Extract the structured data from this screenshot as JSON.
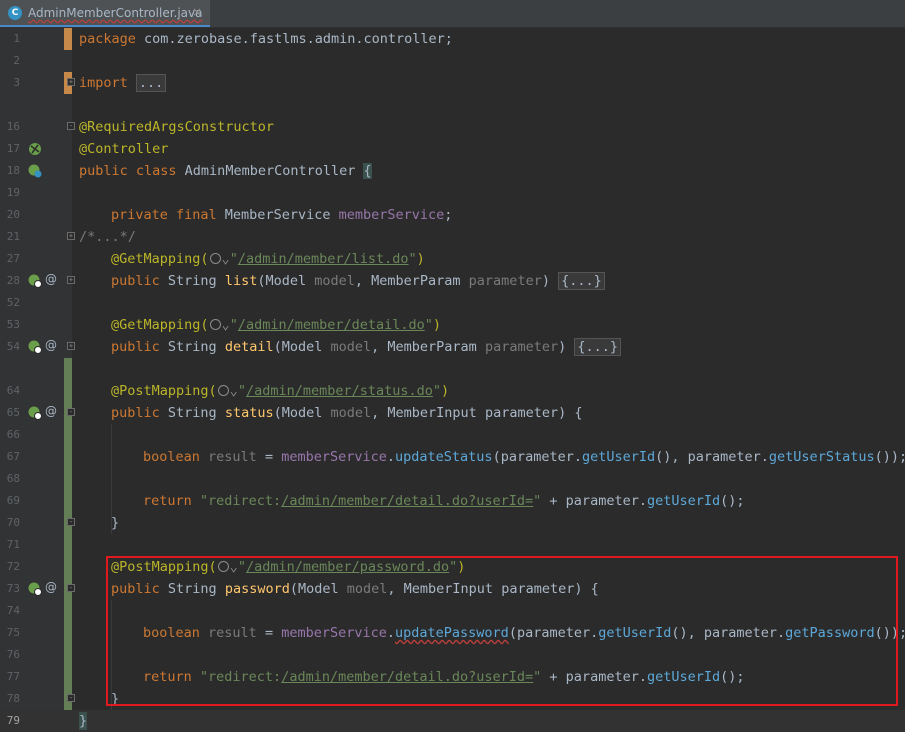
{
  "tab": {
    "filename": "AdminMemberController.java",
    "close": "×",
    "icon_letter": "C"
  },
  "line_numbers": [
    "1",
    "2",
    "3",
    "16",
    "17",
    "18",
    "19",
    "20",
    "21",
    "27",
    "28",
    "52",
    "53",
    "54",
    "64",
    "65",
    "66",
    "67",
    "68",
    "69",
    "70",
    "71",
    "72",
    "73",
    "74",
    "75",
    "76",
    "77",
    "78",
    "79"
  ],
  "code": {
    "l1_kw": "package",
    "l1_rest": " com.zerobase.fastlms.admin.controller;",
    "l3_kw": "import",
    "l3_fold": "...",
    "l16": "@RequiredArgsConstructor",
    "l17": "@Controller",
    "l18_kw": "public class",
    "l18_name": " AdminMemberController ",
    "l18_brace": "{",
    "l20_kw": "private final",
    "l20_type": " MemberService ",
    "l20_field": "memberService",
    "l20_end": ";",
    "l21": "/*...*/",
    "l27_ann": "@GetMapping(",
    "l27_q1": "\"",
    "l27_url": "/admin/member/list.do",
    "l27_q2": "\"",
    "l27_end": ")",
    "l28_kw": "public",
    "l28_type": " String ",
    "l28_m": "list",
    "l28_params": "(Model ",
    "l28_p1": "model",
    "l28_sep": ", MemberParam ",
    "l28_p2": "parameter",
    "l28_close": ") ",
    "l28_fold": "{...}",
    "l53_ann": "@GetMapping(",
    "l53_url": "/admin/member/detail.do",
    "l54_m": "detail",
    "l54_fold": "{...}",
    "l64_ann": "@PostMapping(",
    "l64_url": "/admin/member/status.do",
    "l65_m": "status",
    "l65_sep": ", MemberInput ",
    "l67_kw": "boolean",
    "l67_var": " result",
    "l67_eq": " = ",
    "l67_fld": "memberService",
    "l67_dot": ".",
    "l67_call": "updateStatus",
    "l67_p": "(parameter.",
    "l67_g1": "getUserId",
    "l67_m": "(), parameter.",
    "l67_g2": "getUserStatus",
    "l67_end": "());",
    "l69_kw": "return",
    "l69_str1": " \"redirect:",
    "l69_url": "/admin/member/detail.do?userId=",
    "l69_str2": "\"",
    "l69_plus": " + parameter.",
    "l69_call": "getUserId",
    "l69_end": "();",
    "l70": "}",
    "l72_ann": "@PostMapping(",
    "l72_url": "/admin/member/password.do",
    "l73_m": "password",
    "l75_call": "updatePassword",
    "l75_g2": "getPassword",
    "l78": "}",
    "l79": "}"
  },
  "colors": {
    "highlight_box": "#e0191f",
    "keyword": "#cc7832",
    "annotation": "#bbb529",
    "string": "#6a8759",
    "field": "#9876aa",
    "method": "#ffc66d"
  }
}
